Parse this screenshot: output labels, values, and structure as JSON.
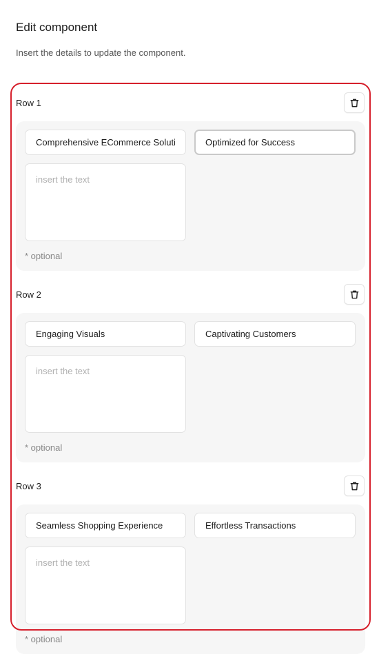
{
  "header": {
    "title": "Edit component",
    "subtitle": "Insert the details to update the component."
  },
  "rows": [
    {
      "label": "Row 1",
      "title_value": "Comprehensive ECommerce Solutions",
      "subtitle_value": "Optimized for Success",
      "text_placeholder": "insert the text",
      "optional_note": "* optional",
      "delete_icon": "trash-icon"
    },
    {
      "label": "Row 2",
      "title_value": "Engaging Visuals",
      "subtitle_value": "Captivating Customers",
      "text_placeholder": "insert the text",
      "optional_note": "* optional",
      "delete_icon": "trash-icon"
    },
    {
      "label": "Row 3",
      "title_value": "Seamless Shopping Experience",
      "subtitle_value": "Effortless Transactions",
      "text_placeholder": "insert the text",
      "optional_note": "* optional",
      "delete_icon": "trash-icon"
    }
  ],
  "colors": {
    "highlight_border": "#d6202c",
    "card_background": "#f6f6f6",
    "input_border": "#e2e2e2"
  }
}
